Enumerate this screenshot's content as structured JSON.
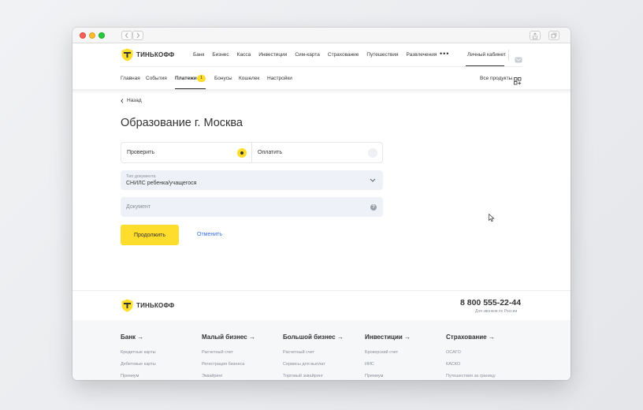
{
  "header": {
    "logo_text": "ТИНЬКОФФ",
    "nav": [
      "Банк",
      "Бизнес",
      "Касса",
      "Инвестиции",
      "Сим-карта",
      "Страхование",
      "Путешествия",
      "Развлечения"
    ],
    "more": "•••",
    "cabinet": "Личный кабинет"
  },
  "subnav": {
    "items": [
      "Главная",
      "События",
      "Платежи",
      "Бонусы",
      "Кошелек",
      "Настройки"
    ],
    "active": "Платежи",
    "badge": "1",
    "all_products": "Все продукты"
  },
  "back_label": "Назад",
  "page_title": "Образование г. Москва",
  "steps": [
    "Проверить",
    "Оплатить"
  ],
  "doc_type": {
    "label": "Тип документа",
    "value": "СНИЛС ребенка/учащегося"
  },
  "document": {
    "placeholder": "Документ"
  },
  "buttons": {
    "continue": "Продолжить",
    "cancel": "Отменить"
  },
  "footer": {
    "logo_text": "ТИНЬКОФФ",
    "phone": "8 800 555-22-44",
    "phone_note": "Для звонков по России",
    "columns": [
      {
        "title": "Банк →",
        "items": [
          "Кредитные карты",
          "Дебетовые карты",
          "Премиум"
        ]
      },
      {
        "title": "Малый бизнес →",
        "items": [
          "Расчетный счет",
          "Регистрация бизнеса",
          "Эквайринг"
        ]
      },
      {
        "title": "Большой бизнес →",
        "items": [
          "Расчетный счет",
          "Сервисы для выплат",
          "Торговый эквайринг"
        ]
      },
      {
        "title": "Инвестиции →",
        "items": [
          "Брокерский счет",
          "ИИС",
          "Премиум"
        ]
      },
      {
        "title": "Страхование →",
        "items": [
          "ОСАГО",
          "КАСКО",
          "Путешествия за границу"
        ]
      }
    ]
  },
  "colors": {
    "accent": "#ffdd2d",
    "link": "#336fee",
    "field_bg": "#eef1f7"
  }
}
